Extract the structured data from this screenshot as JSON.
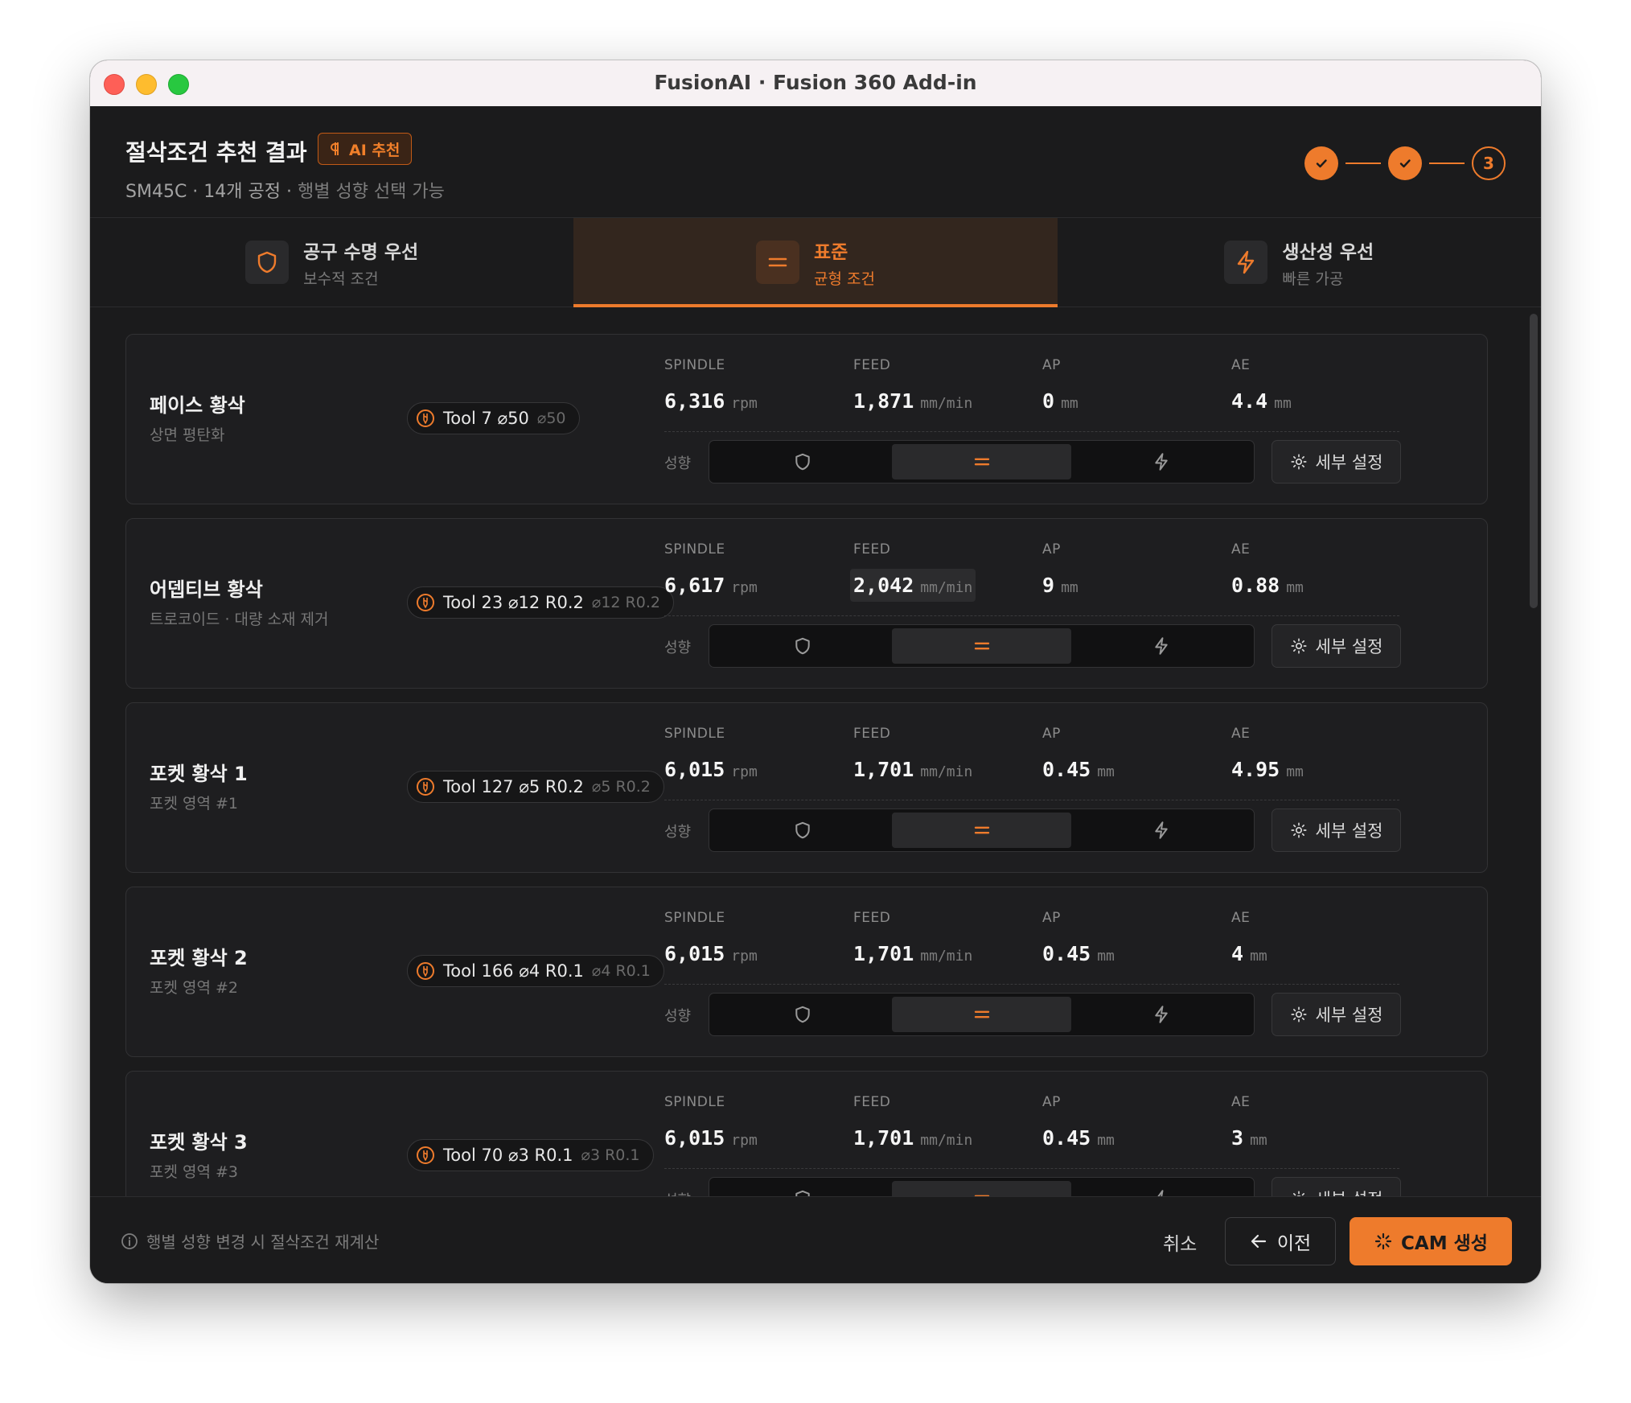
{
  "window": {
    "title": "FusionAI · Fusion 360 Add-in"
  },
  "header": {
    "title": "절삭조건 추천 결과",
    "badge": "AI 추천",
    "subtitle_main": "SM45C · 14개 공정 ·",
    "subtitle_dim": "행별 성향 선택 가능",
    "steps": [
      {
        "state": "done",
        "icon": "check-icon"
      },
      {
        "state": "done",
        "icon": "check-icon"
      },
      {
        "state": "current",
        "label": "3"
      }
    ]
  },
  "tabs": [
    {
      "label": "공구 수명 우선",
      "sub": "보수적 조건",
      "icon": "shield-icon",
      "active": false
    },
    {
      "label": "표준",
      "sub": "균형 조건",
      "icon": "equals-icon",
      "active": true
    },
    {
      "label": "생산성 우선",
      "sub": "빠른 가공",
      "icon": "bolt-icon",
      "active": false
    }
  ],
  "labels": {
    "spindle": "SPINDLE",
    "feed": "FEED",
    "ap": "AP",
    "ae": "AE",
    "tendency": "성향",
    "detail": "세부 설정",
    "unit_rpm": "rpm",
    "unit_feed": "mm/min",
    "unit_mm": "mm"
  },
  "operations": [
    {
      "name": "페이스 황삭",
      "sub": "상면 평탄화",
      "tool": "Tool 7 ⌀50",
      "tool_dim": "⌀50",
      "spindle": "6,316",
      "feed": "1,871",
      "ap": "0",
      "ae": "4.4",
      "tendency": "standard"
    },
    {
      "name": "어뎁티브 황삭",
      "sub": "트로코이드 · 대량 소재 제거",
      "tool": "Tool 23 ⌀12 R0.2",
      "tool_dim": "⌀12 R0.2",
      "spindle": "6,617",
      "feed": "2,042",
      "ap": "9",
      "ae": "0.88",
      "tendency": "standard",
      "feed_highlight": true
    },
    {
      "name": "포켓 황삭 1",
      "sub": "포켓 영역 #1",
      "tool": "Tool 127 ⌀5 R0.2",
      "tool_dim": "⌀5 R0.2",
      "spindle": "6,015",
      "feed": "1,701",
      "ap": "0.45",
      "ae": "4.95",
      "tendency": "standard"
    },
    {
      "name": "포켓 황삭 2",
      "sub": "포켓 영역 #2",
      "tool": "Tool 166 ⌀4 R0.1",
      "tool_dim": "⌀4 R0.1",
      "spindle": "6,015",
      "feed": "1,701",
      "ap": "0.45",
      "ae": "4",
      "tendency": "standard"
    },
    {
      "name": "포켓 황삭 3",
      "sub": "포켓 영역 #3",
      "tool": "Tool 70 ⌀3 R0.1",
      "tool_dim": "⌀3 R0.1",
      "spindle": "6,015",
      "feed": "1,701",
      "ap": "0.45",
      "ae": "3",
      "tendency": "standard"
    }
  ],
  "footer": {
    "note": "행별 성향 변경 시 절삭조건 재계산",
    "cancel": "취소",
    "prev": "이전",
    "generate": "CAM 생성"
  },
  "colors": {
    "accent": "#ee7b2c",
    "background": "#1b1b1c"
  }
}
